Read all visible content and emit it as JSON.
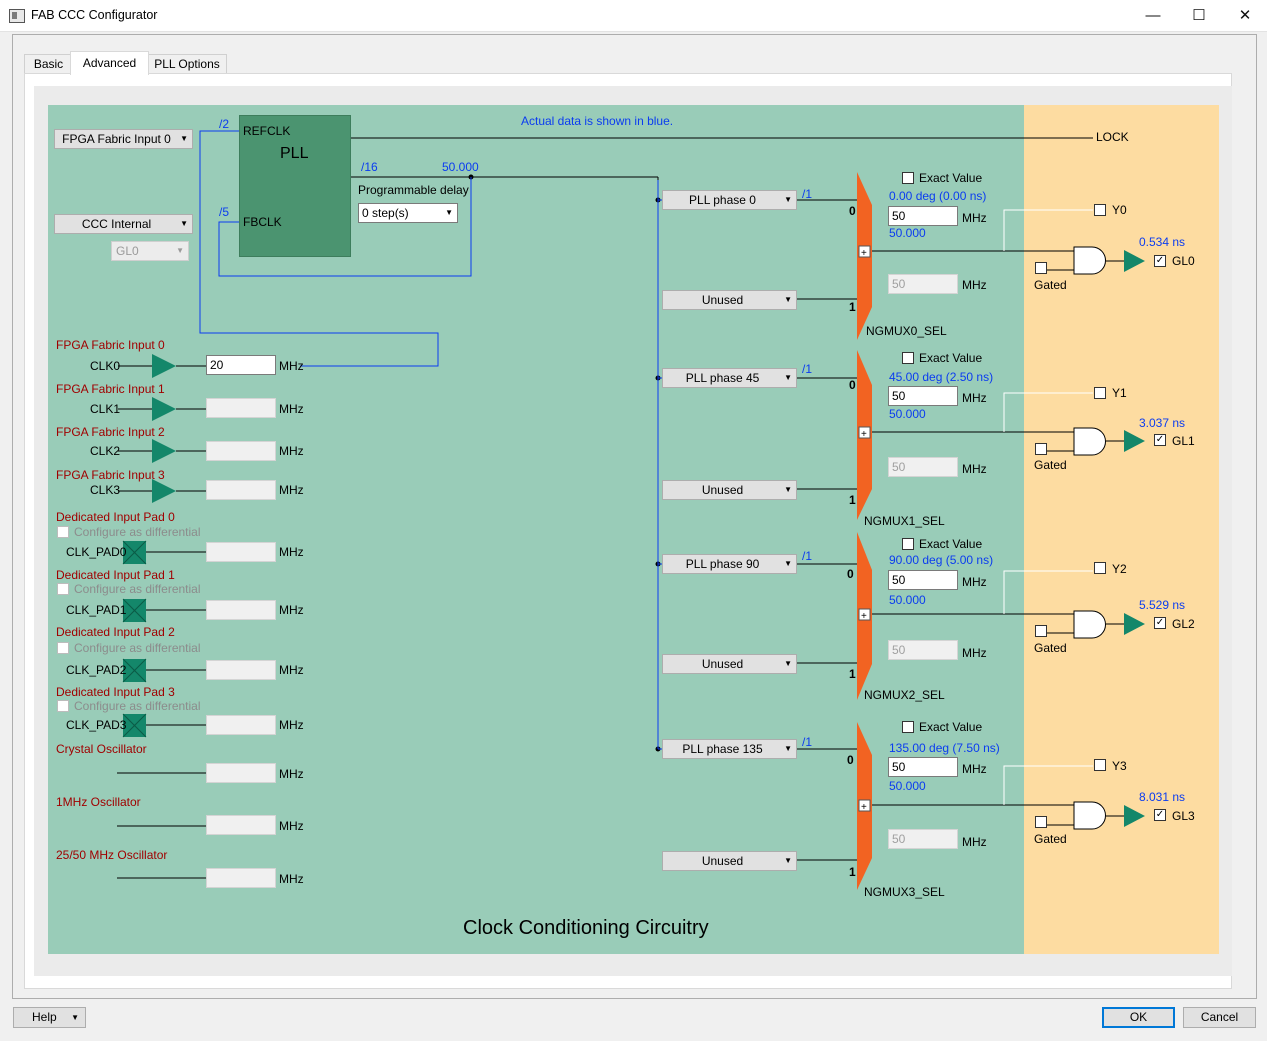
{
  "window": {
    "title": "FAB CCC Configurator"
  },
  "tabs": [
    {
      "label": "Basic"
    },
    {
      "label": "Advanced"
    },
    {
      "label": "PLL Options"
    }
  ],
  "diagram": {
    "pll": {
      "title": "PLL",
      "refclk_label": "REFCLK",
      "fbclk_label": "FBCLK",
      "ref_divider": "/2",
      "fb_divider": "/5",
      "out_divider": "/16",
      "out_freq": "50.000",
      "delay_label": "Programmable delay",
      "delay_value": "0 step(s)"
    },
    "info_text": "Actual data is shown in blue.",
    "lock_label": "LOCK",
    "ref_source": "FPGA Fabric Input 0",
    "fb_source": "CCC Internal",
    "fb_gl": "GL0",
    "footer_title": "Clock Conditioning Circuitry",
    "mhz": "MHz",
    "fabric_inputs": [
      {
        "title": "FPGA Fabric Input 0",
        "clk": "CLK0",
        "value": "20"
      },
      {
        "title": "FPGA Fabric Input 1",
        "clk": "CLK1",
        "value": ""
      },
      {
        "title": "FPGA Fabric Input 2",
        "clk": "CLK2",
        "value": ""
      },
      {
        "title": "FPGA Fabric Input 3",
        "clk": "CLK3",
        "value": ""
      }
    ],
    "pads": [
      {
        "title": "Dedicated Input Pad 0",
        "diff": "Configure as differential",
        "clk": "CLK_PAD0"
      },
      {
        "title": "Dedicated Input Pad 1",
        "diff": "Configure as differential",
        "clk": "CLK_PAD1"
      },
      {
        "title": "Dedicated Input Pad 2",
        "diff": "Configure as differential",
        "clk": "CLK_PAD2"
      },
      {
        "title": "Dedicated Input Pad 3",
        "diff": "Configure as differential",
        "clk": "CLK_PAD3"
      }
    ],
    "oscillators": [
      {
        "title": "Crystal Oscillator"
      },
      {
        "title": "1MHz Oscillator"
      },
      {
        "title": "25/50 MHz Oscillator"
      }
    ],
    "outputs": [
      {
        "phase": "PLL phase 0",
        "div": "/1",
        "exact": "Exact Value",
        "deg": "0.00 deg (0.00 ns)",
        "freq": "50",
        "actual": "50.000",
        "unused": "Unused",
        "freq1": "50",
        "mux": "NGMUX0_SEL",
        "y": "Y0",
        "gated": "Gated",
        "delay": "0.534 ns",
        "gl": "GL0",
        "sel0": "0",
        "sel1": "1"
      },
      {
        "phase": "PLL phase 45",
        "div": "/1",
        "exact": "Exact Value",
        "deg": "45.00 deg (2.50 ns)",
        "freq": "50",
        "actual": "50.000",
        "unused": "Unused",
        "freq1": "50",
        "mux": "NGMUX1_SEL",
        "y": "Y1",
        "gated": "Gated",
        "delay": "3.037 ns",
        "gl": "GL1",
        "sel0": "0",
        "sel1": "1"
      },
      {
        "phase": "PLL phase 90",
        "div": "/1",
        "exact": "Exact Value",
        "deg": "90.00 deg (5.00 ns)",
        "freq": "50",
        "actual": "50.000",
        "unused": "Unused",
        "freq1": "50",
        "mux": "NGMUX2_SEL",
        "y": "Y2",
        "gated": "Gated",
        "delay": "5.529 ns",
        "gl": "GL2",
        "sel0": "0",
        "sel1": "1"
      },
      {
        "phase": "PLL phase 135",
        "div": "/1",
        "exact": "Exact Value",
        "deg": "135.00 deg (7.50 ns)",
        "freq": "50",
        "actual": "50.000",
        "unused": "Unused",
        "freq1": "50",
        "mux": "NGMUX3_SEL",
        "y": "Y3",
        "gated": "Gated",
        "delay": "8.031 ns",
        "gl": "GL3",
        "sel0": "0",
        "sel1": "1"
      }
    ]
  },
  "footer": {
    "help": "Help",
    "ok": "OK",
    "cancel": "Cancel"
  },
  "colors": {
    "panel_green": "#99ccb8",
    "panel_orange": "#fddca1",
    "pll_block": "#4b9470",
    "buffer": "#14876a",
    "mux": "#f26322",
    "wire_blue": "#0b3cf0",
    "label_red": "#a00000"
  }
}
